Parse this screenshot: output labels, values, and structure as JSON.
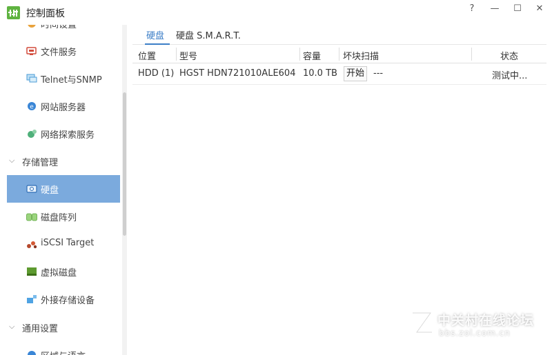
{
  "window": {
    "title": "控制面板",
    "help": "?",
    "minimize": "—",
    "maximize": "☐",
    "close": "✕"
  },
  "sidebar": {
    "items": [
      {
        "label": "时间设置",
        "icon": "clock-icon"
      },
      {
        "label": "文件服务",
        "icon": "file-service-icon"
      },
      {
        "label": "Telnet与SNMP",
        "icon": "monitor-icon"
      },
      {
        "label": "网站服务器",
        "icon": "web-icon"
      },
      {
        "label": "网络探索服务",
        "icon": "network-discovery-icon"
      },
      {
        "label": "存储管理",
        "group": true
      },
      {
        "label": "硬盘",
        "icon": "hdd-icon",
        "selected": true
      },
      {
        "label": "磁盘阵列",
        "icon": "raid-icon"
      },
      {
        "label": "iSCSI Target",
        "icon": "iscsi-icon"
      },
      {
        "label": "虚拟磁盘",
        "icon": "virtual-disk-icon"
      },
      {
        "label": "外接存储设备",
        "icon": "external-storage-icon"
      },
      {
        "label": "通用设置",
        "group": true
      },
      {
        "label": "区域与语言",
        "icon": "region-icon"
      }
    ]
  },
  "tabs": [
    {
      "label": "硬盘",
      "active": true
    },
    {
      "label": "硬盘 S.M.A.R.T.",
      "active": false
    }
  ],
  "table": {
    "columns": [
      "位置",
      "型号",
      "容量",
      "坏块扫描",
      "状态"
    ],
    "rows": [
      {
        "location": "HDD (1)",
        "model": "HGST HDN721010ALE604",
        "capacity": "10.0 TB",
        "scan_button": "开始",
        "scan_result": "---",
        "status": "测试中..."
      }
    ]
  },
  "watermark": {
    "text": "中关村在线论坛",
    "url": "bbs.zol.com.cn"
  },
  "colors": {
    "accent": "#3b7ec7",
    "selected": "#7baadd",
    "app_icon": "#5fb340"
  }
}
